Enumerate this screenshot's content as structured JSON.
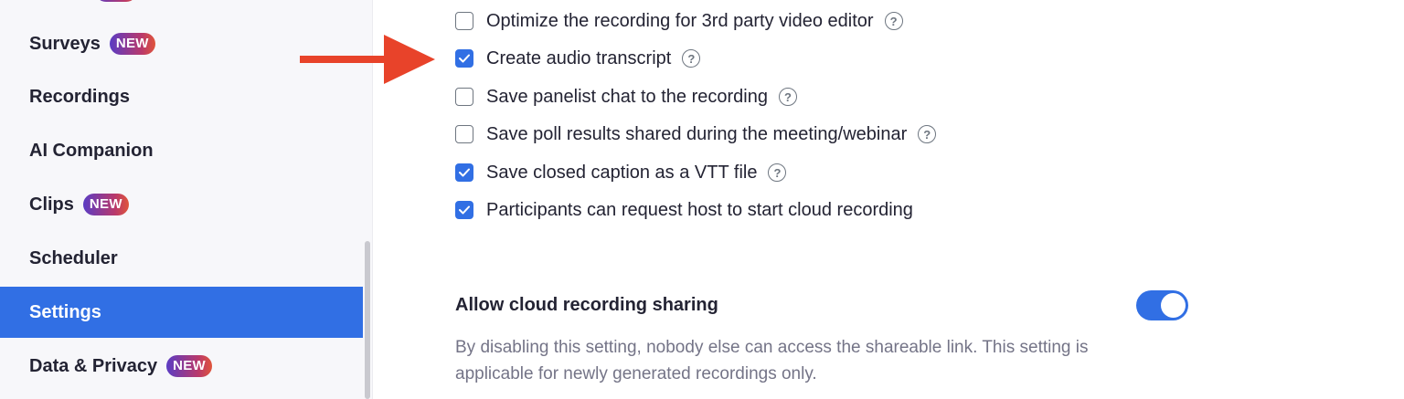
{
  "sidebar": {
    "badge": "NEW",
    "items": [
      {
        "label": "Surveys",
        "badge": "NEW"
      },
      {
        "label": "Recordings"
      },
      {
        "label": "AI Companion"
      },
      {
        "label": "Clips",
        "badge": "NEW"
      },
      {
        "label": "Scheduler"
      },
      {
        "label": "Settings",
        "active": true
      },
      {
        "label": "Data & Privacy",
        "badge": "NEW"
      }
    ]
  },
  "options": [
    {
      "label": "Optimize the recording for 3rd party video editor",
      "checked": false,
      "help": true
    },
    {
      "label": "Create audio transcript",
      "checked": true,
      "help": true
    },
    {
      "label": "Save panelist chat to the recording",
      "checked": false,
      "help": true
    },
    {
      "label": "Save poll results shared during the meeting/webinar",
      "checked": false,
      "help": true
    },
    {
      "label": "Save closed caption as a VTT file",
      "checked": true,
      "help": true
    },
    {
      "label": "Participants can request host to start cloud recording",
      "checked": true,
      "help": false
    }
  ],
  "help_glyph": "?",
  "cloud_sharing": {
    "title": "Allow cloud recording sharing",
    "description": "By disabling this setting, nobody else can access the shareable link. This setting is applicable for newly generated recordings only.",
    "enabled": true
  },
  "annotation": {
    "arrow_color": "#e8432a",
    "points_to": "Create audio transcript"
  },
  "colors": {
    "accent": "#316fe4",
    "active_sidebar": "#316fe4",
    "badge_gradient_start": "#5b3cc4",
    "badge_gradient_end": "#e0553a"
  }
}
